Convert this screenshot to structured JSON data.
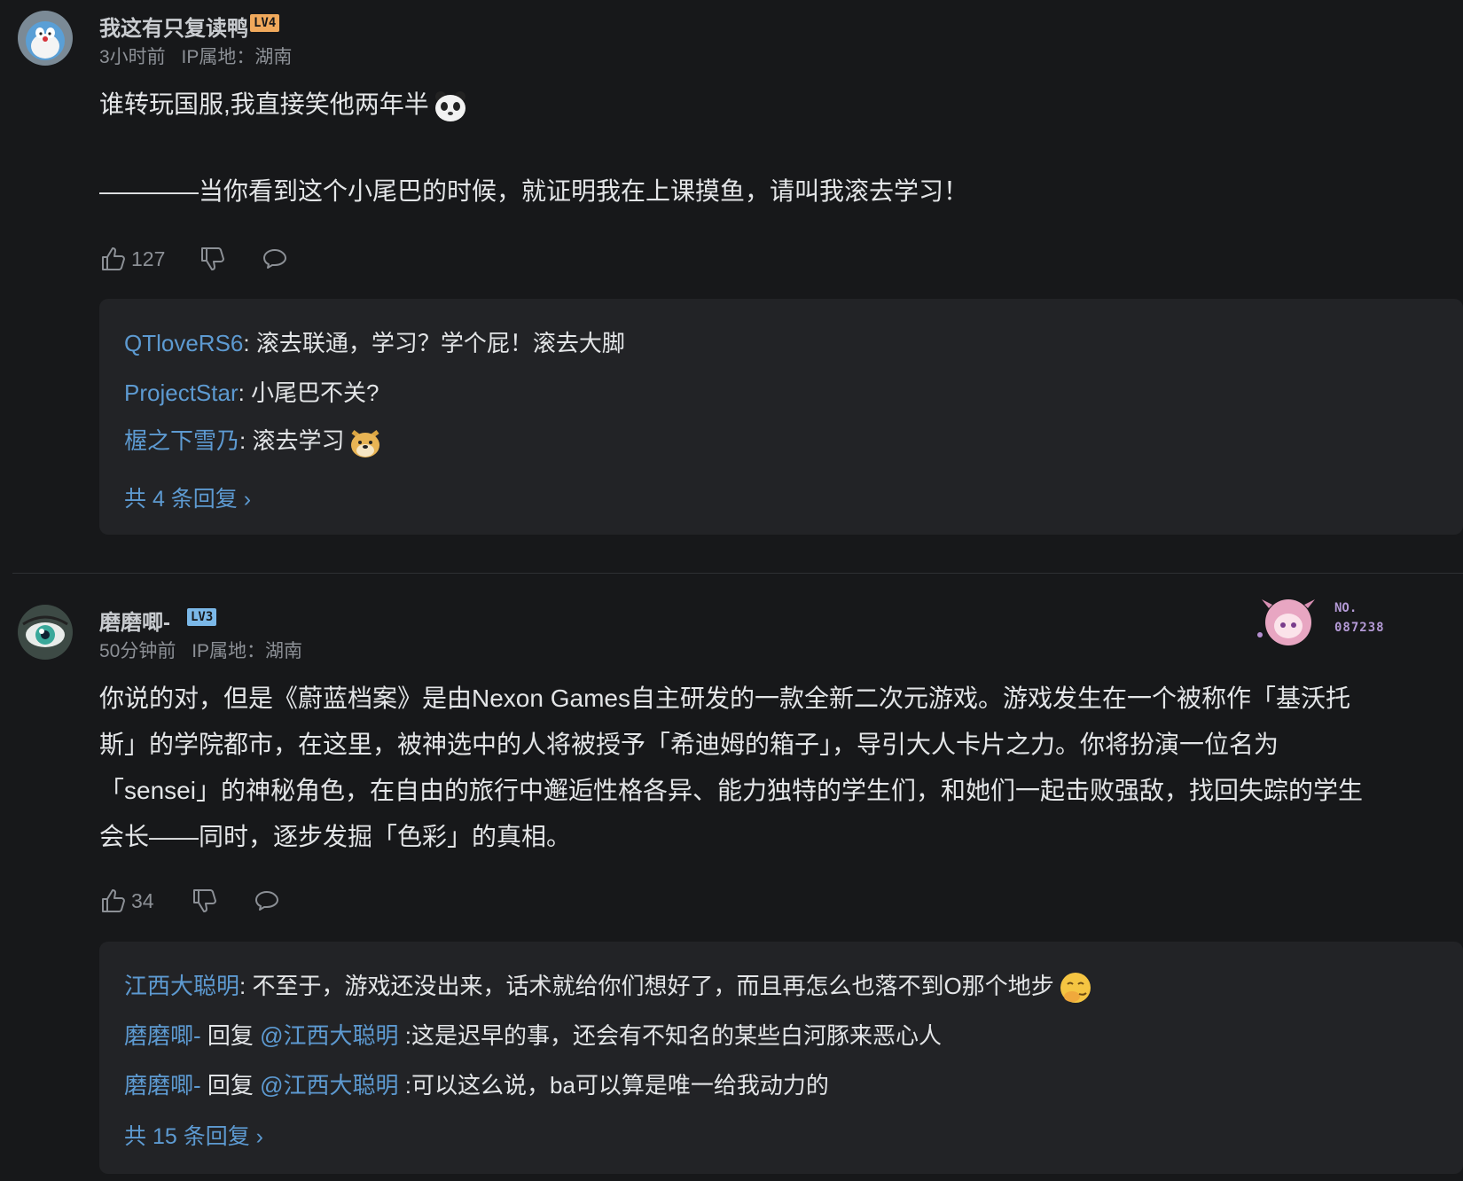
{
  "comments": [
    {
      "username": "我这有只复读鸭",
      "level": "LV4",
      "level_color": "#f0a95c",
      "time": "3小时前",
      "ip": "IP属地：湖南",
      "content_line1": "谁转玩国服,我直接笑他两年半",
      "content_line2": "————当你看到这个小尾巴的时候，就证明我在上课摸鱼，请叫我滚去学习！",
      "likes": "127",
      "replies": [
        {
          "user": "QTloveRS6",
          "text": ": 滚去联通，学习？学个屁！滚去大脚"
        },
        {
          "user": "ProjectStar",
          "text": ": 小尾巴不关?"
        },
        {
          "user": "楃之下雪乃",
          "text": ": 滚去学习"
        }
      ],
      "more": "共 4 条回复 ›"
    },
    {
      "username": "磨磨唧-",
      "level": "LV3",
      "level_color": "#7bb8e8",
      "time": "50分钟前",
      "ip": "IP属地：湖南",
      "content": [
        "你说的对，但是《蔚蓝档案》是由Nexon Games自主研发的一款全新二次元游戏。游戏发生在一个被称作「基沃托",
        "斯」的学院都市，在这里，被神选中的人将被授予「希迪姆的箱子」，导引大人卡片之力。你将扮演一位名为",
        "「sensei」的神秘角色，在自由的旅行中邂逅性格各异、能力独特的学生们，和她们一起击败强敌，找回失踪的学生",
        "会长——同时，逐步发掘「色彩」的真相。"
      ],
      "likes": "34",
      "badge_no": "NO.",
      "badge_num": "087238",
      "replies": [
        {
          "user": "江西大聪明",
          "text": ": 不至于，游戏还没出来，话术就给你们想好了，而且再怎么也落不到O那个地步"
        },
        {
          "user": "磨磨唧-",
          "mid": " 回复 ",
          "at": "@江西大聪明",
          "text": " :这是迟早的事，还会有不知名的某些白河豚来恶心人"
        },
        {
          "user": "磨磨唧-",
          "mid": " 回复 ",
          "at": "@江西大聪明",
          "text": " :可以这么说，ba可以算是唯一给我动力的"
        }
      ],
      "more": "共 15 条回复 ›"
    }
  ]
}
